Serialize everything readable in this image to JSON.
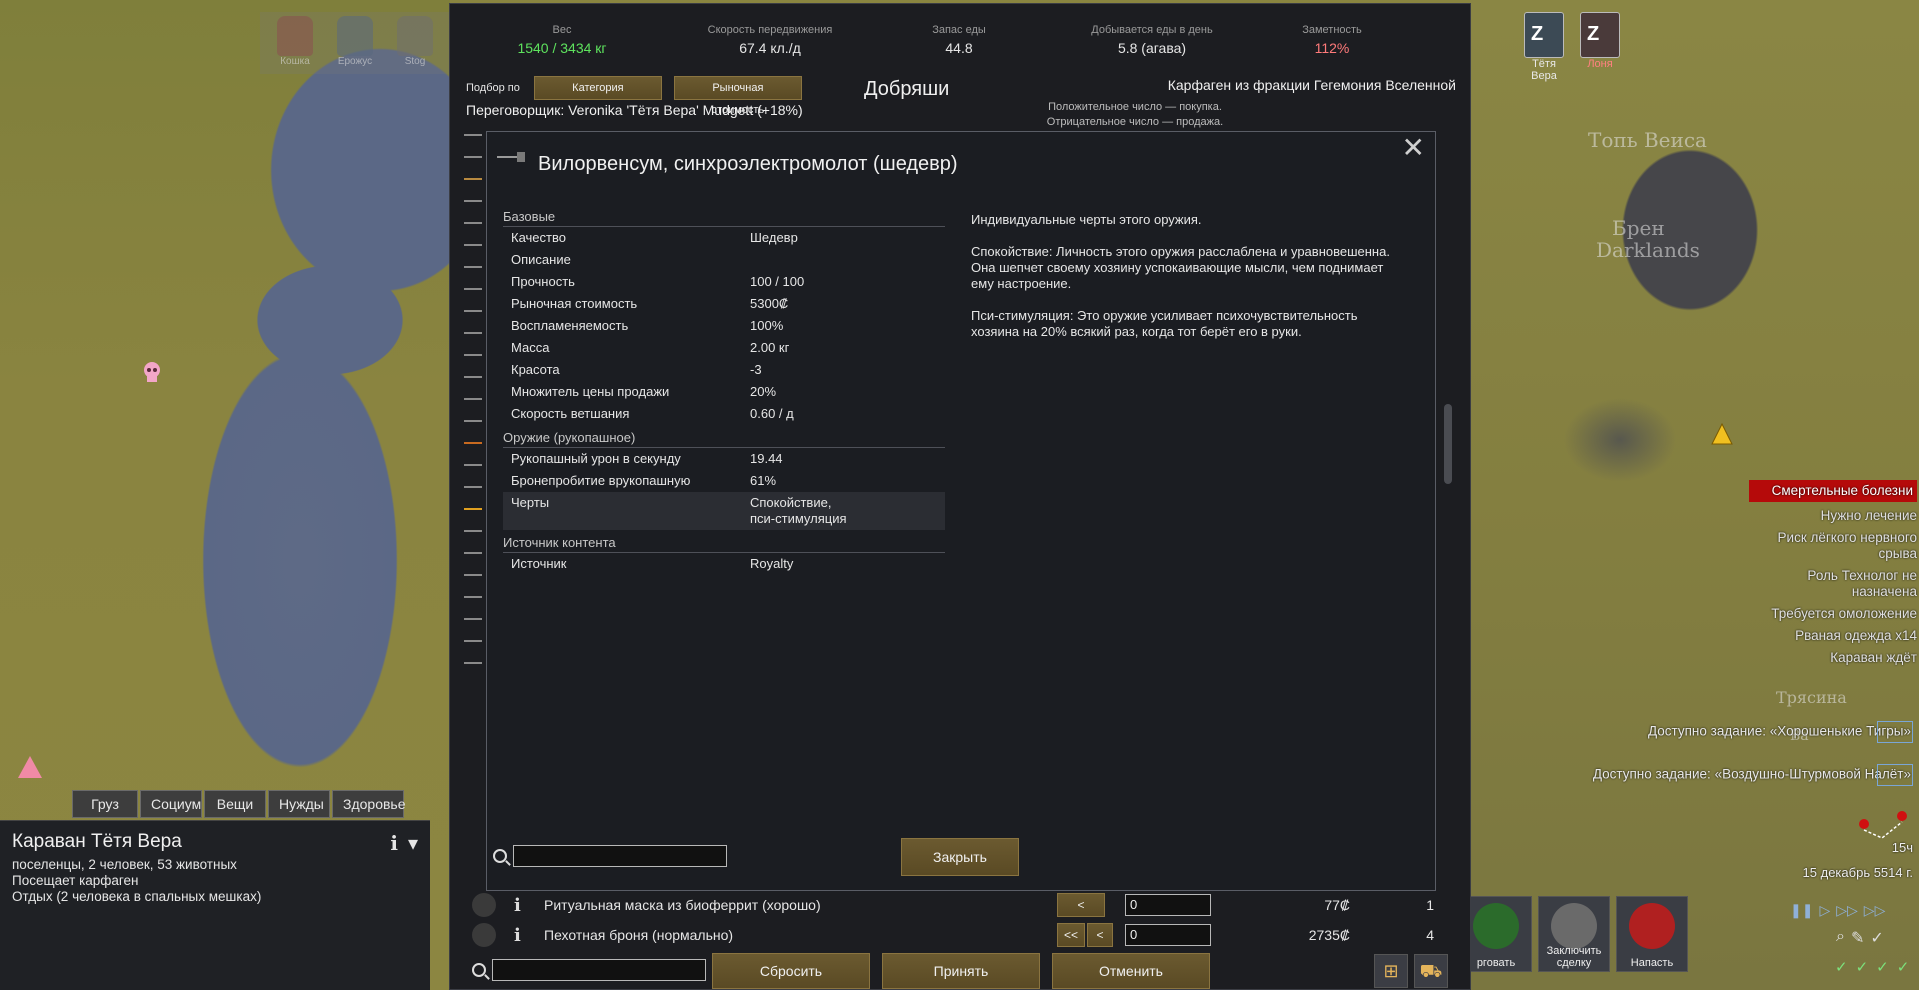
{
  "map": {
    "labels": [
      "Топь Веиса",
      "Брен",
      "Darklands",
      "Трясина",
      "Ва"
    ]
  },
  "colonists_left": [
    {
      "name": "Кошка"
    },
    {
      "name": "Ерожус"
    },
    {
      "name": "Stog"
    }
  ],
  "colonists_right": [
    {
      "name": "Тётя Вера",
      "status": "Z"
    },
    {
      "name": "Лоня",
      "status": "Z"
    }
  ],
  "alerts": [
    {
      "text": "Смертельные болезни",
      "danger": true
    },
    {
      "text": "Нужно лечение"
    },
    {
      "text": "Риск лёгкого нервного срыва"
    },
    {
      "text": "Роль Технолог не назначена"
    },
    {
      "text": "Требуется омоложение"
    },
    {
      "text": "Рваная одежда x14"
    },
    {
      "text": "Караван ждёт"
    }
  ],
  "quests": [
    "Доступно задание: «Хорошенькие Тигры»",
    "Доступно задание: «Воздушно-Штурмовой Налёт»"
  ],
  "time": {
    "hour": "15ч",
    "date": "15 декабрь 5514 г."
  },
  "bottom_right_buttons": [
    {
      "label": "рговать",
      "icon": "trade-icon"
    },
    {
      "label": "Заключить сделку",
      "icon": "deal-icon"
    },
    {
      "label": "Напасть",
      "icon": "attack-icon"
    }
  ],
  "inspect": {
    "tabs": [
      "Груз",
      "Социум",
      "Вещи",
      "Нужды",
      "Здоровье"
    ],
    "title": "Караван Тётя Вера",
    "lines": [
      "поселенцы, 2 человек, 53 животных",
      "Посещает карфаген",
      "Отдых (2 человека в спальных мешках)"
    ]
  },
  "trade": {
    "stats": [
      {
        "label": "Вес",
        "value": "1540 / 3434 кг",
        "color": "#5ee35e"
      },
      {
        "label": "Скорость передвижения",
        "value": "67.4 кл./д"
      },
      {
        "label": "Запас еды",
        "value": "44.8"
      },
      {
        "label": "Добывается еды в день",
        "value": "5.8 (агава)"
      },
      {
        "label": "Заметность",
        "value": "112%",
        "color": "#ff7a7a"
      }
    ],
    "sort_label": "Подбор по",
    "sort_buttons": [
      "Категория",
      "Рыночная стоимость"
    ],
    "trader_name": "Добряши",
    "faction": "Карфаген из фракции Гегемония Вселенной",
    "negotiator": "Переговорщик: Veronika 'Тётя Вера' Mudgett (+18%)",
    "hint_lines": [
      "Положительное число — покупка.",
      "Отрицательное число — продажа."
    ],
    "rows": [
      {
        "name": "Ритуальная маска из биоферрит (хорошо)",
        "arrows": [
          "<"
        ],
        "qty": "0",
        "price": "77₡",
        "count": "1"
      },
      {
        "name": "Пехотная броня (нормально)",
        "arrows": [
          "<<",
          "<"
        ],
        "qty": "0",
        "price": "2735₡",
        "count": "4"
      }
    ],
    "footer": {
      "reset": "Сбросить",
      "accept": "Принять",
      "cancel": "Отменить"
    }
  },
  "dialog": {
    "title": "Вилорвенсум, синхроэлектромолот (шедевр)",
    "close_button": "Закрыть",
    "sections": [
      {
        "name": "Базовые",
        "rows": [
          {
            "k": "Качество",
            "v": "Шедевр"
          },
          {
            "k": "Описание",
            "v": ""
          },
          {
            "k": "Прочность",
            "v": "100 / 100"
          },
          {
            "k": "Рыночная стоимость",
            "v": "5300₡"
          },
          {
            "k": "Воспламеняемость",
            "v": "100%"
          },
          {
            "k": "Масса",
            "v": "2.00 кг"
          },
          {
            "k": "Красота",
            "v": "-3"
          },
          {
            "k": "Множитель цены продажи",
            "v": "20%"
          },
          {
            "k": "Скорость ветшания",
            "v": "0.60 / д"
          }
        ]
      },
      {
        "name": "Оружие (рукопашное)",
        "rows": [
          {
            "k": "Рукопашный урон в секунду",
            "v": "19.44"
          },
          {
            "k": "Бронепробитие врукопашную",
            "v": "61%"
          },
          {
            "k": "Черты",
            "v": "Спокойствие,\nпси-стимуляция",
            "hl": true
          }
        ]
      },
      {
        "name": "Источник контента",
        "rows": [
          {
            "k": "Источник",
            "v": "Royalty"
          }
        ]
      }
    ],
    "description": [
      "Индивидуальные черты этого оружия.",
      "Спокойствие: Личность этого оружия расслаблена и уравновешенна. Она шепчет своему хозяину успокаивающие мысли, чем поднимает ему настроение.",
      "Пси-стимуляция: Это оружие усиливает психочувствительность хозяина на 20% всякий раз, когда тот берёт его в руки."
    ]
  }
}
